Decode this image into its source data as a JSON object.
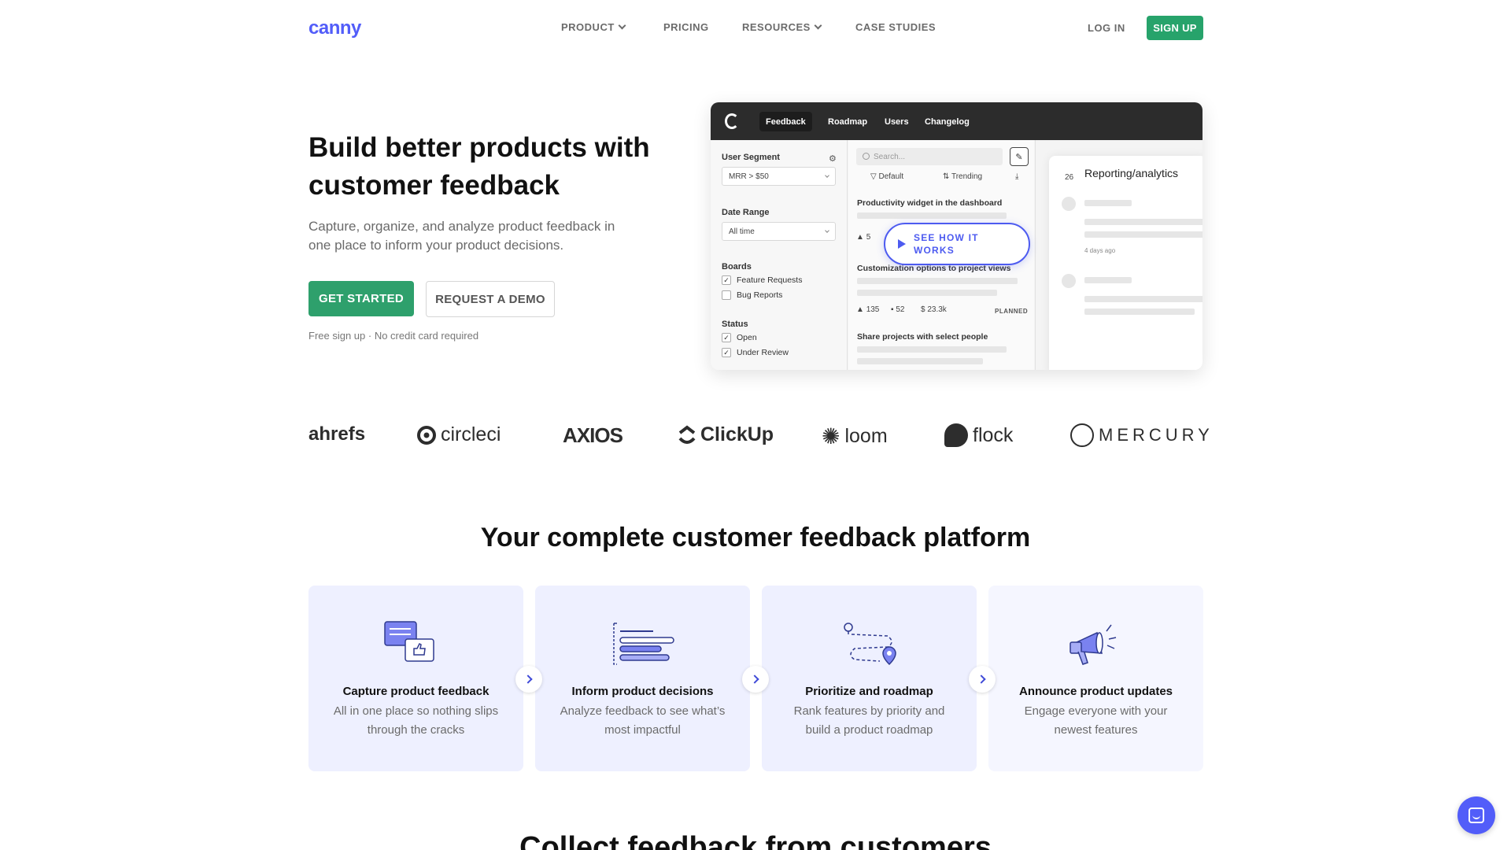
{
  "nav": {
    "logo": "canny",
    "links": [
      {
        "label": "PRODUCT",
        "dropdown": true
      },
      {
        "label": "PRICING",
        "dropdown": false
      },
      {
        "label": "RESOURCES",
        "dropdown": true
      },
      {
        "label": "CASE STUDIES",
        "dropdown": false
      }
    ],
    "login": "LOG IN",
    "signup": "SIGN UP"
  },
  "hero": {
    "title": "Build better products with customer feedback",
    "subtitle": "Capture, organize, and analyze product feedback in one place to inform your product decisions.",
    "cta_primary": "GET STARTED",
    "cta_secondary": "REQUEST A DEMO",
    "fine_print": "Free sign up · No credit card required"
  },
  "mock": {
    "tabs": [
      "Feedback",
      "Roadmap",
      "Users",
      "Changelog"
    ],
    "active_tab": "Feedback",
    "sidebar": {
      "segment_label": "User Segment",
      "segment_value": "MRR > $50",
      "date_label": "Date Range",
      "date_value": "All time",
      "boards_label": "Boards",
      "boards": [
        {
          "label": "Feature Requests",
          "checked": true
        },
        {
          "label": "Bug Reports",
          "checked": false
        }
      ],
      "status_label": "Status",
      "statuses": [
        {
          "label": "Open",
          "checked": true
        },
        {
          "label": "Under Review",
          "checked": true
        }
      ]
    },
    "search_placeholder": "Search...",
    "filters": [
      "Default",
      "Trending"
    ],
    "posts": [
      {
        "title": "Productivity widget in the dashboard",
        "votes": "5"
      },
      {
        "title": "Customization options to project views"
      },
      {
        "title": "Share projects with select people"
      }
    ],
    "stats": {
      "votes": "135",
      "comments": "52",
      "mrr": "$ 23.3k",
      "status": "PLANNED"
    },
    "detail": {
      "votes": "26",
      "title": "Reporting/analytics",
      "time": "4 days ago"
    },
    "play_label": "SEE HOW IT WORKS"
  },
  "logos": [
    "ahrefs",
    "circleci",
    "AXIOS",
    "ClickUp",
    "loom",
    "flock",
    "MERCURY"
  ],
  "platform": {
    "title": "Your complete customer feedback platform",
    "cards": [
      {
        "title": "Capture product feedback",
        "desc": "All in one place so nothing slips through the cracks"
      },
      {
        "title": "Inform product decisions",
        "desc": "Analyze feedback to see what’s most impactful"
      },
      {
        "title": "Prioritize and roadmap",
        "desc": "Rank features by priority and build a product roadmap"
      },
      {
        "title": "Announce product updates",
        "desc": "Engage everyone with your newest features"
      }
    ]
  },
  "next_section_title": "Collect feedback from customers",
  "colors": {
    "brand": "#525df9",
    "cta": "#2ea06c",
    "card_bg": "#eef0ff"
  }
}
